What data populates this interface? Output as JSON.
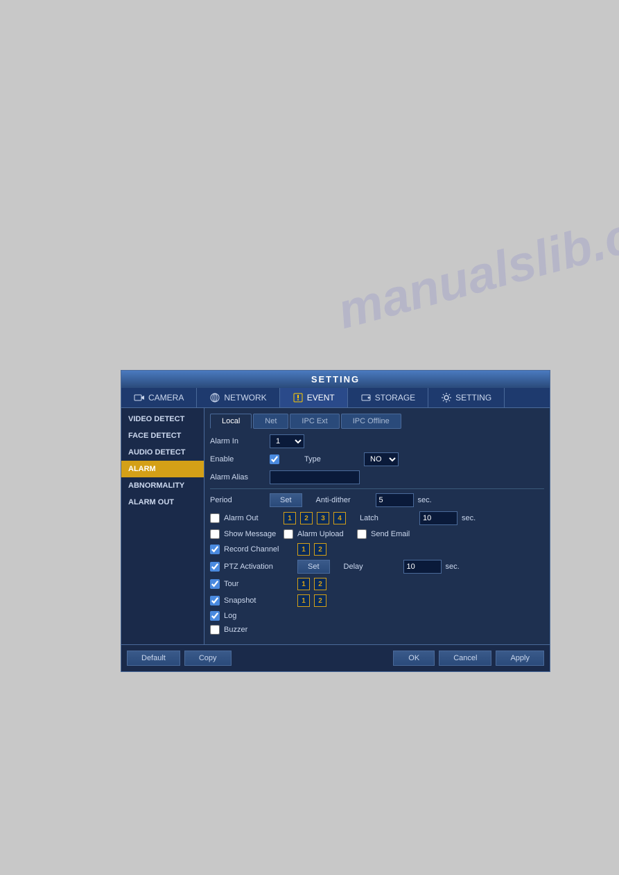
{
  "watermark": "manualslib.com",
  "dialog": {
    "title": "SETTING",
    "top_nav": [
      {
        "id": "camera",
        "label": "CAMERA",
        "icon": "camera"
      },
      {
        "id": "network",
        "label": "NETWORK",
        "icon": "network"
      },
      {
        "id": "event",
        "label": "EVENT",
        "icon": "event",
        "active": true
      },
      {
        "id": "storage",
        "label": "STORAGE",
        "icon": "storage"
      },
      {
        "id": "setting",
        "label": "SETTING",
        "icon": "setting"
      }
    ],
    "sidebar": [
      {
        "id": "video-detect",
        "label": "VIDEO DETECT"
      },
      {
        "id": "face-detect",
        "label": "FACE DETECT"
      },
      {
        "id": "audio-detect",
        "label": "AUDIO DETECT"
      },
      {
        "id": "alarm",
        "label": "ALARM",
        "active": true
      },
      {
        "id": "abnormality",
        "label": "ABNORMALITY"
      },
      {
        "id": "alarm-out",
        "label": "ALARM OUT"
      }
    ],
    "sub_tabs": [
      {
        "id": "local",
        "label": "Local",
        "active": true
      },
      {
        "id": "net",
        "label": "Net"
      },
      {
        "id": "ipc-ext",
        "label": "IPC Ext"
      },
      {
        "id": "ipc-offline",
        "label": "IPC Offline"
      }
    ],
    "form": {
      "alarm_in_label": "Alarm In",
      "alarm_in_value": "1",
      "enable_label": "Enable",
      "type_label": "Type",
      "type_value": "NO",
      "alarm_alias_label": "Alarm Alias",
      "alarm_alias_value": "",
      "period_label": "Period",
      "set_label": "Set",
      "anti_dither_label": "Anti-dither",
      "anti_dither_value": "5",
      "sec1": "sec.",
      "alarm_out_label": "Alarm Out",
      "alarm_out_nums": [
        "1",
        "2",
        "3",
        "4"
      ],
      "latch_label": "Latch",
      "latch_value": "10",
      "sec2": "sec.",
      "show_message_label": "Show Message",
      "alarm_upload_label": "Alarm Upload",
      "send_email_label": "Send Email",
      "record_channel_label": "Record Channel",
      "record_nums": [
        "1",
        "2"
      ],
      "ptz_activation_label": "PTZ Activation",
      "ptz_set_label": "Set",
      "delay_label": "Delay",
      "delay_value": "10",
      "sec3": "sec.",
      "tour_label": "Tour",
      "tour_nums": [
        "1",
        "2"
      ],
      "snapshot_label": "Snapshot",
      "snapshot_nums": [
        "1",
        "2"
      ],
      "log_label": "Log",
      "buzzer_label": "Buzzer"
    },
    "bottom_buttons": {
      "default_label": "Default",
      "copy_label": "Copy",
      "ok_label": "OK",
      "cancel_label": "Cancel",
      "apply_label": "Apply"
    }
  }
}
